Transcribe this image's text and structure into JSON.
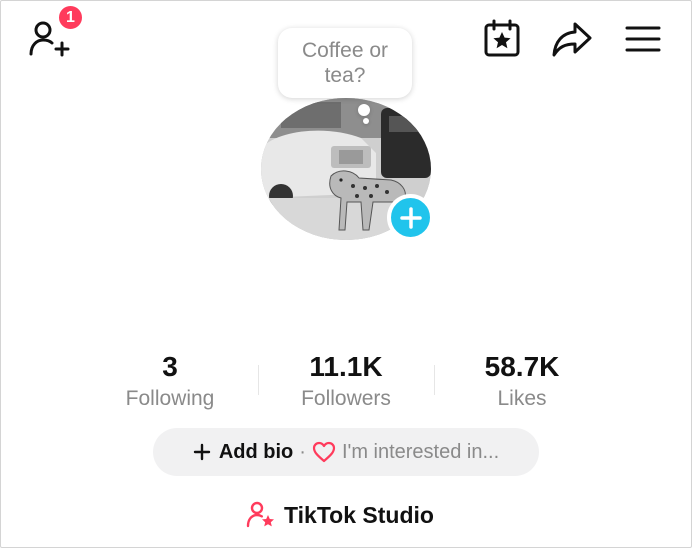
{
  "header": {
    "notification_count": "1",
    "icons": [
      "add-friend-icon",
      "calendar-star-icon",
      "share-icon",
      "menu-icon"
    ]
  },
  "profile": {
    "note_text": "Coffee or tea?"
  },
  "stats": [
    {
      "value": "3",
      "label": "Following"
    },
    {
      "value": "11.1K",
      "label": "Followers"
    },
    {
      "value": "58.7K",
      "label": "Likes"
    }
  ],
  "bio": {
    "add_label": "Add bio",
    "separator": "·",
    "interest_placeholder": "I'm interested in..."
  },
  "studio": {
    "label": "TikTok Studio"
  },
  "colors": {
    "accent_red": "#ff3b5c",
    "avatar_add": "#20c4ec",
    "muted_text": "#8a8a8a",
    "pill_bg": "#f1f1f2"
  }
}
